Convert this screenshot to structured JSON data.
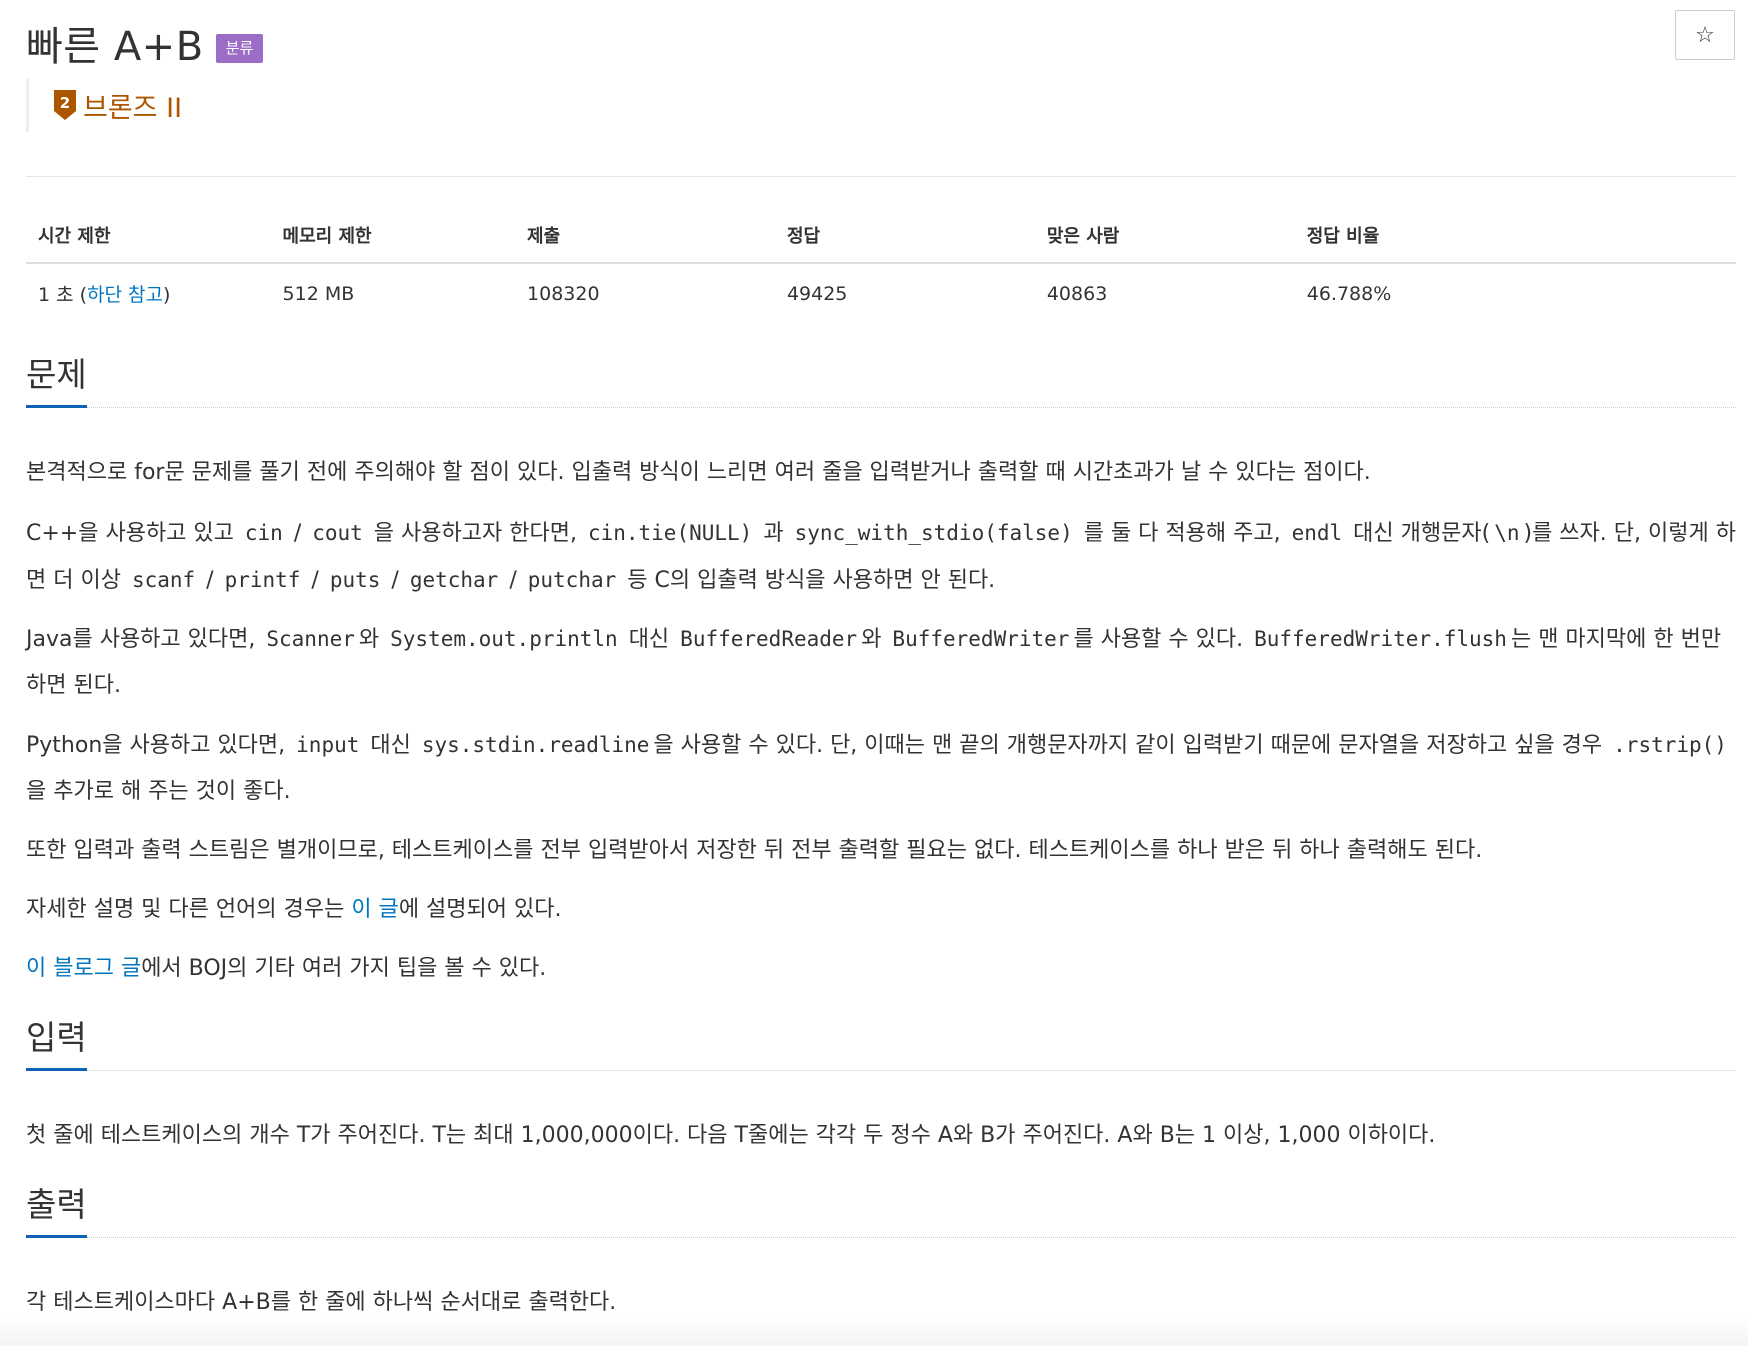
{
  "header": {
    "title": "빠른 A+B",
    "category_badge": "분류",
    "star_icon": "☆",
    "tier": {
      "icon_number": "2",
      "label": "브론즈 II",
      "color": "#ad5600"
    }
  },
  "info_table": {
    "headers": [
      "시간 제한",
      "메모리 제한",
      "제출",
      "정답",
      "맞은 사람",
      "정답 비율"
    ],
    "time_limit": {
      "prefix": "1 초 (",
      "link": "하단 참고",
      "suffix": ")"
    },
    "memory_limit": "512 MB",
    "submissions": "108320",
    "accepted": "49425",
    "solvers": "40863",
    "ratio": "46.788%"
  },
  "problem": {
    "title": "문제",
    "p1": "본격적으로 for문 문제를 풀기 전에 주의해야 할 점이 있다. 입출력 방식이 느리면 여러 줄을 입력받거나 출력할 때 시간초과가 날 수 있다는 점이다.",
    "p2": {
      "t1": "C++을 사용하고 있고 ",
      "c1": "cin",
      "t2": " / ",
      "c2": "cout",
      "t3": " 을 사용하고자 한다면, ",
      "c3": "cin.tie(NULL)",
      "t4": " 과 ",
      "c4": "sync_with_stdio(false)",
      "t5": " 를 둘 다 적용해 주고, ",
      "c5": "endl",
      "t6": " 대신 개행문자(",
      "c6": "\\n",
      "t7": ")를 쓰자. 단, 이렇게 하면 더 이상 ",
      "c7": "scanf",
      "t8": " / ",
      "c8": "printf",
      "t9": " / ",
      "c9": "puts",
      "t10": " / ",
      "c10": "getchar",
      "t11": " / ",
      "c11": "putchar",
      "t12": " 등 C의 입출력 방식을 사용하면 안 된다."
    },
    "p3": {
      "t1": "Java를 사용하고 있다면, ",
      "c1": "Scanner",
      "t2": "와 ",
      "c2": "System.out.println",
      "t3": " 대신 ",
      "c3": "BufferedReader",
      "t4": "와 ",
      "c4": "BufferedWriter",
      "t5": "를 사용할 수 있다. ",
      "c5": "BufferedWriter.flush",
      "t6": "는 맨 마지막에 한 번만 하면 된다."
    },
    "p4": {
      "t1": "Python을 사용하고 있다면, ",
      "c1": "input",
      "t2": " 대신 ",
      "c2": "sys.stdin.readline",
      "t3": "을 사용할 수 있다. 단, 이때는 맨 끝의 개행문자까지 같이 입력받기 때문에 문자열을 저장하고 싶을 경우 ",
      "c3": ".rstrip()",
      "t4": "을 추가로 해 주는 것이 좋다."
    },
    "p5": "또한 입력과 출력 스트림은 별개이므로, 테스트케이스를 전부 입력받아서 저장한 뒤 전부 출력할 필요는 없다. 테스트케이스를 하나 받은 뒤 하나 출력해도 된다.",
    "p6": {
      "t1": "자세한 설명 및 다른 언어의 경우는 ",
      "link": "이 글",
      "t2": "에 설명되어 있다."
    },
    "p7": {
      "link": "이 블로그 글",
      "t1": "에서 BOJ의 기타 여러 가지 팁을 볼 수 있다."
    }
  },
  "input": {
    "title": "입력",
    "text": "첫 줄에 테스트케이스의 개수 T가 주어진다. T는 최대 1,000,000이다. 다음 T줄에는 각각 두 정수 A와 B가 주어진다. A와 B는 1 이상, 1,000 이하이다."
  },
  "output": {
    "title": "출력",
    "text": "각 테스트케이스마다 A+B를 한 줄에 하나씩 순서대로 출력한다."
  }
}
